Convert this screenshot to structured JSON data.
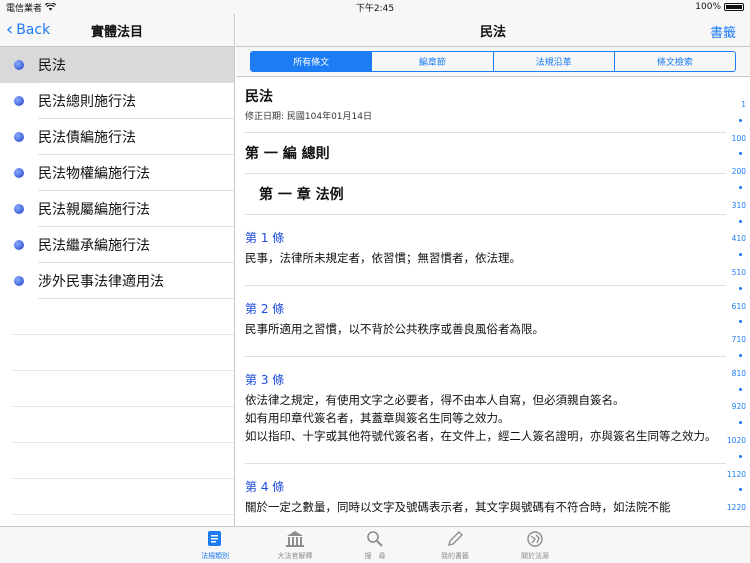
{
  "status": {
    "carrier": "電信業者",
    "time": "下午2:45",
    "battery": "100%"
  },
  "left": {
    "back_label": "Back",
    "title": "實體法目",
    "items": [
      "民法",
      "民法總則施行法",
      "民法債編施行法",
      "民法物權編施行法",
      "民法親屬編施行法",
      "民法繼承編施行法",
      "涉外民事法律適用法"
    ]
  },
  "right": {
    "title": "民法",
    "bookmark_label": "書籤",
    "segments": [
      "所有條文",
      "編章節",
      "法規沿革",
      "條文檢索"
    ],
    "doc_title": "民法",
    "doc_date": "修正日期: 民國104年01月14日",
    "part": "第 一 編 總則",
    "chapter": "第 一 章 法例",
    "articles": [
      {
        "num": "第 1 條",
        "lines": [
          "民事，法律所未規定者，依習慣；無習慣者，依法理。"
        ]
      },
      {
        "num": "第 2 條",
        "lines": [
          "民事所適用之習慣，以不背於公共秩序或善良風俗者為限。"
        ]
      },
      {
        "num": "第 3 條",
        "lines": [
          "依法律之規定，有使用文字之必要者，得不由本人自寫，但必須親自簽名。",
          "如有用印章代簽名者，其蓋章與簽名生同等之效力。",
          "如以指印、十字或其他符號代簽名者，在文件上，經二人簽名證明，亦與簽名生同等之效力。"
        ]
      },
      {
        "num": "第 4 條",
        "lines": [
          "關於一定之數量，同時以文字及號碼表示者，其文字與號碼有不符合時，如法院不能"
        ]
      }
    ],
    "index": [
      "1",
      "100",
      "200",
      "310",
      "410",
      "510",
      "610",
      "710",
      "810",
      "920",
      "1020",
      "1120",
      "1220"
    ]
  },
  "tabs": [
    "法規類別",
    "大法官解釋",
    "搜　尋",
    "我的書籤",
    "關於法源"
  ],
  "colors": {
    "accent": "#1c7cf4",
    "article_num": "#1c4bd8",
    "selected_row": "#d9d9d9"
  }
}
